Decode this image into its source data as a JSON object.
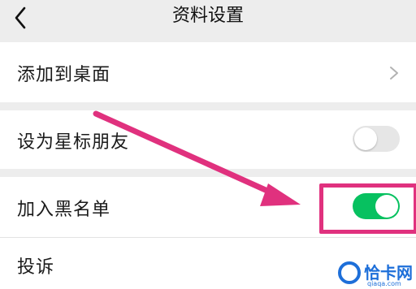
{
  "header": {
    "title": "资料设置"
  },
  "rows": [
    {
      "label": "添加到桌面"
    },
    {
      "label": "设为星标朋友",
      "toggle": false
    },
    {
      "label": "加入黑名单",
      "toggle": true
    },
    {
      "label": "投诉"
    }
  ],
  "colors": {
    "toggle_on": "#07c160",
    "toggle_off": "#e6e6e6",
    "highlight": "#e0317e",
    "watermark": "#1e6fd9"
  },
  "watermark": {
    "name": "恰卡网",
    "url": "qiaqa.com"
  },
  "icons": [
    "back-arrow-icon",
    "chevron-right-icon"
  ]
}
